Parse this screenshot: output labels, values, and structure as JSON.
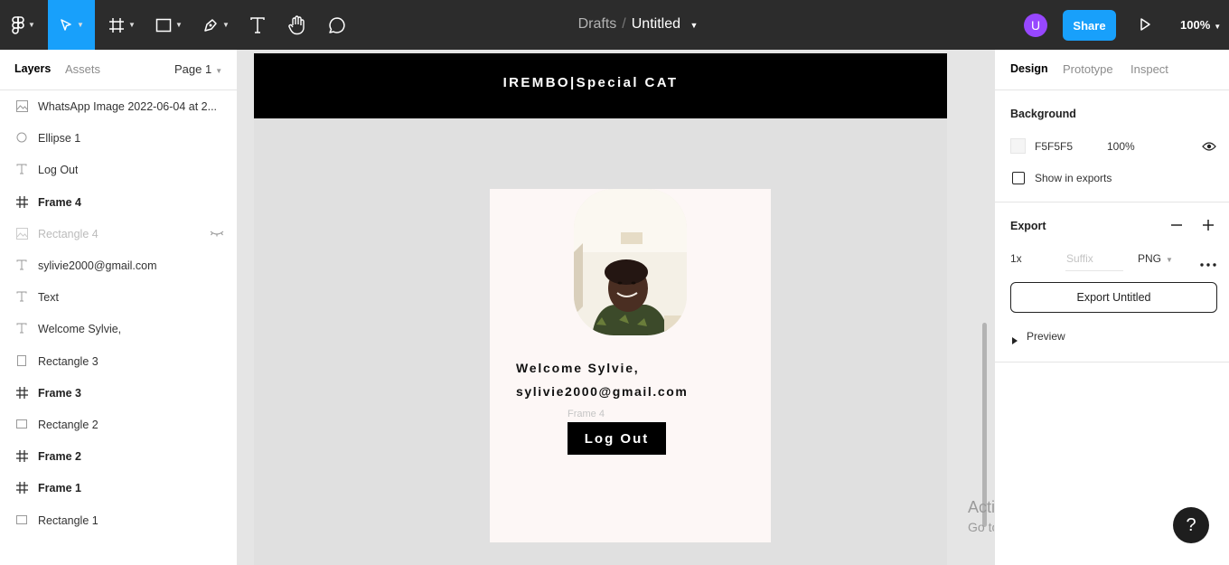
{
  "toolbar": {
    "breadcrumb_root": "Drafts",
    "breadcrumb_sep": "/",
    "doc_title": "Untitled",
    "caret": "⌄",
    "avatar_initial": "U",
    "share_label": "Share",
    "zoom_label": "100%"
  },
  "left_panel": {
    "tabs": [
      {
        "label": "Layers"
      },
      {
        "label": "Assets"
      }
    ],
    "page_selector": "Page 1",
    "layers": [
      {
        "name": "WhatsApp Image 2022-06-04 at 2...",
        "icon": "image-icon",
        "kind": "image"
      },
      {
        "name": "Ellipse 1",
        "icon": "ellipse-icon",
        "kind": "ellipse"
      },
      {
        "name": "Log Out",
        "icon": "text-icon",
        "kind": "text"
      },
      {
        "name": "Frame 4",
        "icon": "frame-icon",
        "kind": "frame"
      },
      {
        "name": "Rectangle 4",
        "icon": "image-icon",
        "kind": "hidden"
      },
      {
        "name": "sylivie2000@gmail.com",
        "icon": "text-icon",
        "kind": "text"
      },
      {
        "name": "Text",
        "icon": "text-icon",
        "kind": "text"
      },
      {
        "name": "Welcome Sylvie,",
        "icon": "text-icon",
        "kind": "text"
      },
      {
        "name": "Rectangle 3",
        "icon": "rectangle-icon",
        "kind": "rect"
      },
      {
        "name": "Frame 3",
        "icon": "frame-icon",
        "kind": "frame"
      },
      {
        "name": "Rectangle 2",
        "icon": "rectangle-icon",
        "kind": "rect"
      },
      {
        "name": "Frame 2",
        "icon": "frame-icon",
        "kind": "frame"
      },
      {
        "name": "Frame 1",
        "icon": "frame-icon",
        "kind": "frame"
      },
      {
        "name": "Rectangle 1",
        "icon": "rectangle-icon",
        "kind": "rect"
      }
    ]
  },
  "canvas": {
    "header_title": "IREMBO|Special CAT",
    "welcome_text": "Welcome Sylvie,",
    "email_text": "sylivie2000@gmail.com",
    "frame_label": "Frame 4",
    "logout_label": "Log Out",
    "watermark_title": "Activate Windows",
    "watermark_subtitle": "Go to Settings to activate Windows.",
    "help_label": "?"
  },
  "right_panel": {
    "tabs": [
      {
        "label": "Design"
      },
      {
        "label": "Prototype"
      },
      {
        "label": "Inspect"
      }
    ],
    "background": {
      "title": "Background",
      "color_hex": "F5F5F5",
      "opacity": "100%",
      "show_in_exports": "Show in exports"
    },
    "export": {
      "title": "Export",
      "scale": "1x",
      "suffix_placeholder": "Suffix",
      "format": "PNG",
      "export_button": "Export Untitled",
      "preview_label": "Preview"
    }
  },
  "colors": {
    "accent": "#18a0fb",
    "avatar": "#9747ff",
    "toolbar_bg": "#2c2c2c"
  }
}
